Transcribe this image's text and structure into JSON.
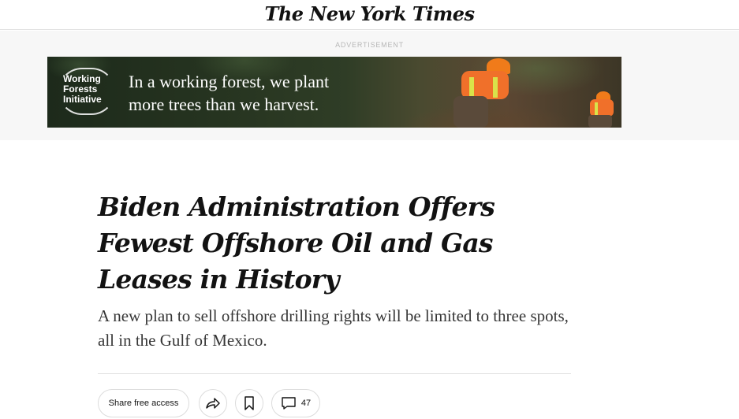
{
  "masthead": {
    "logo_text": "The New York Times"
  },
  "ad": {
    "label": "ADVERTISEMENT",
    "logo_text": "Working Forests Initiative",
    "headline_line1": "In a working forest, we plant",
    "headline_line2": "more trees than we harvest."
  },
  "article": {
    "headline": "Biden Administration Offers Fewest Offshore Oil and Gas Leases in History",
    "summary": "A new plan to sell offshore drilling rights will be limited to three spots, all in the Gulf of Mexico."
  },
  "actions": {
    "share_free_label": "Share free access",
    "share_icon": "share-arrow-icon",
    "save_icon": "bookmark-icon",
    "comments_icon": "comment-bubble-icon",
    "comments_count": "47"
  }
}
